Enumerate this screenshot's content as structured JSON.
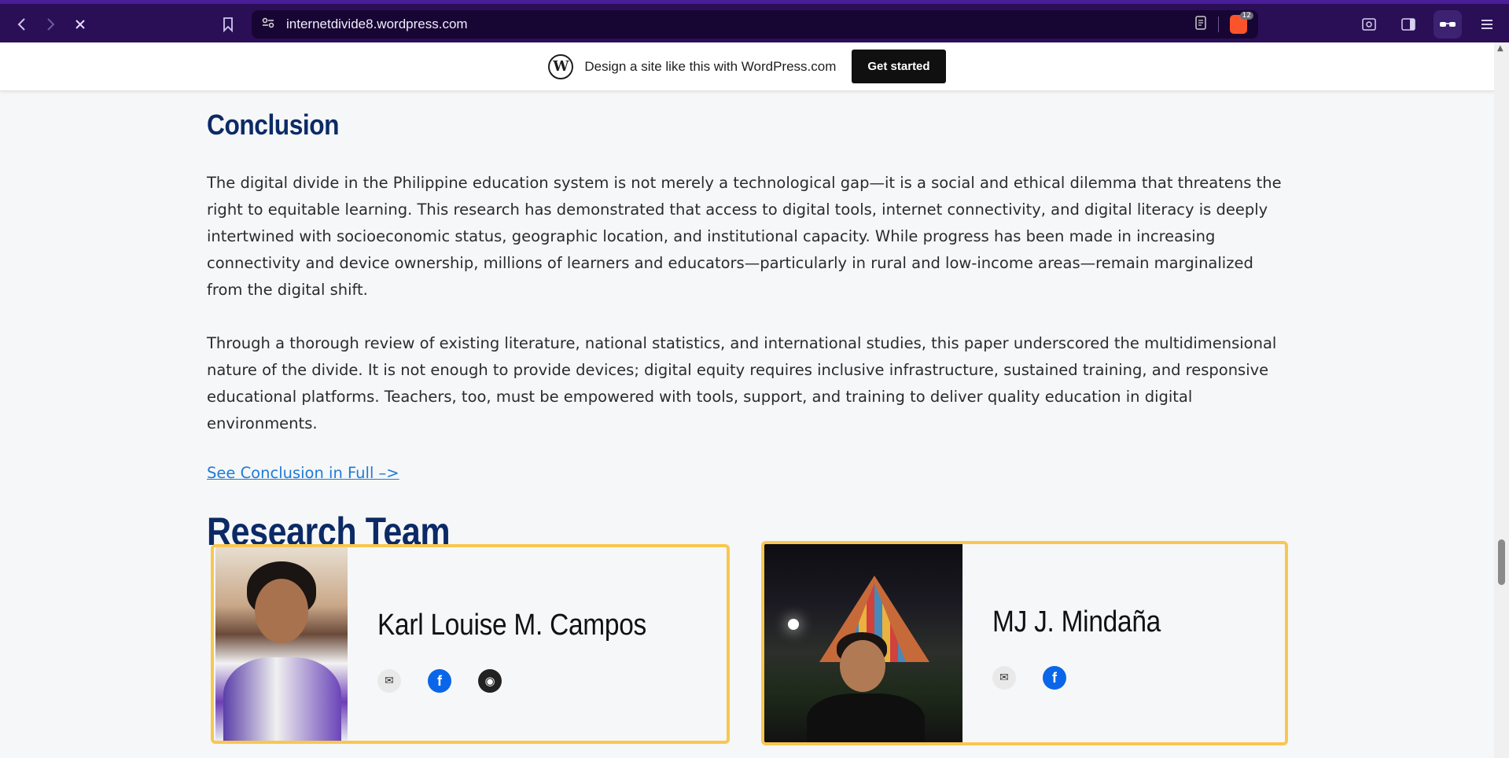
{
  "browser": {
    "url": "internetdivide8.wordpress.com",
    "shields_count": "12"
  },
  "banner": {
    "text": "Design a site like this with WordPress.com",
    "button": "Get started",
    "logo": "W"
  },
  "conclusion": {
    "heading": "Conclusion",
    "paragraph1": "The digital divide in the Philippine education system is not merely a technological gap—it is a social and ethical dilemma that threatens the right to equitable learning. This research has demonstrated that access to digital tools, internet connectivity, and digital literacy is deeply intertwined with socioeconomic status, geographic location, and institutional capacity. While progress has been made in increasing connectivity and device ownership, millions of learners and educators—particularly in rural and low-income areas—remain marginalized from the digital shift.",
    "paragraph2": "Through a thorough review of existing literature, national statistics, and international studies, this paper underscored the multidimensional nature of the divide. It is not enough to provide devices; digital equity requires inclusive infrastructure, sustained training, and responsive educational platforms. Teachers, too, must be empowered with tools, support, and training to deliver quality education in digital environments.",
    "link": "See Conclusion in Full –>"
  },
  "team": {
    "heading": "Research Team",
    "members": [
      {
        "name": "Karl Louise M. Campos",
        "socials": [
          "mail-icon",
          "facebook-icon",
          "github-icon"
        ]
      },
      {
        "name": "MJ J. Mindaña",
        "socials": [
          "mail-icon",
          "facebook-icon"
        ]
      }
    ]
  },
  "colors": {
    "browser_bar": "#2a0f57",
    "heading": "#0b2a66",
    "link": "#1f7ad8",
    "card_border": "#f9c74f",
    "facebook": "#0a66e8"
  }
}
